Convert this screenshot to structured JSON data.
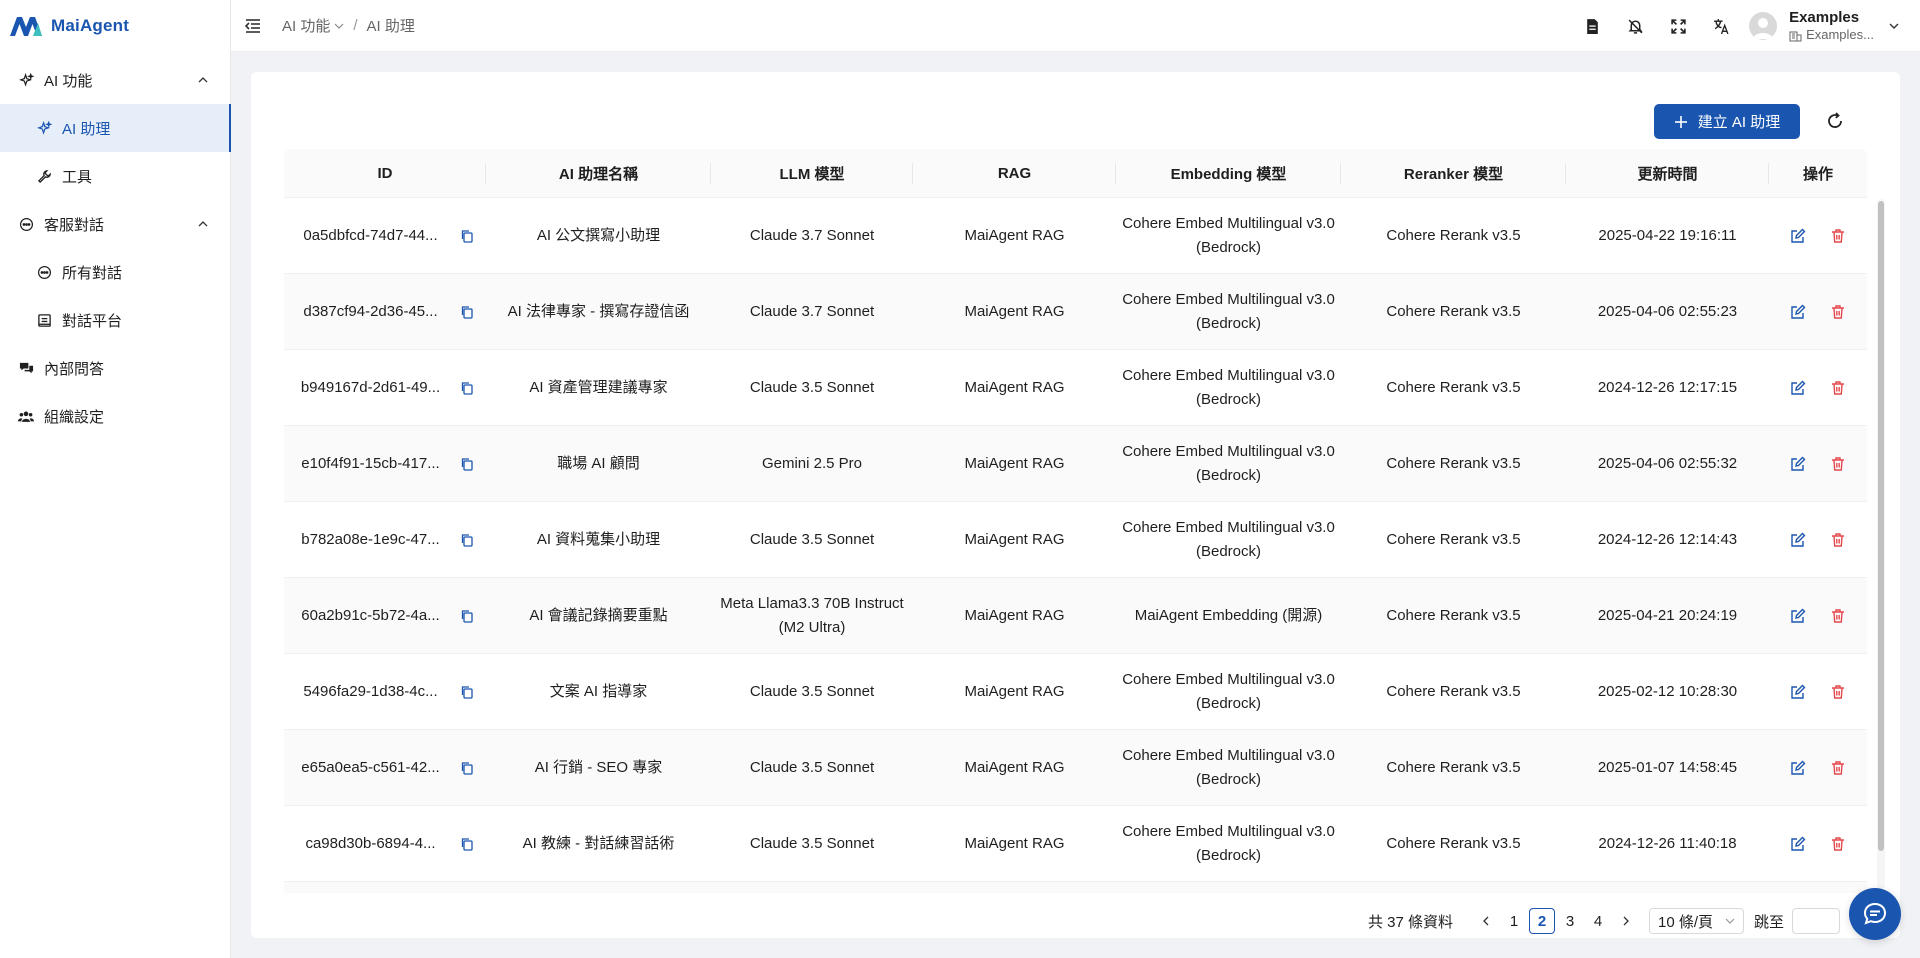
{
  "brand": {
    "name": "MaiAgent",
    "color": "#1a56b0"
  },
  "sidebar": {
    "groups": [
      {
        "label": "AI 功能",
        "icon": "sparkle-icon",
        "expanded": true,
        "items": [
          {
            "label": "AI 助理",
            "icon": "sparkle-icon",
            "active": true
          },
          {
            "label": "工具",
            "icon": "wrench-icon",
            "active": false
          }
        ]
      },
      {
        "label": "客服對話",
        "icon": "chat-bubble-icon",
        "expanded": true,
        "items": [
          {
            "label": "所有對話",
            "icon": "chat-bubble-icon",
            "active": false
          },
          {
            "label": "對話平台",
            "icon": "platform-icon",
            "active": false
          }
        ]
      },
      {
        "label": "內部問答",
        "icon": "comments-icon",
        "expanded": false,
        "items": []
      },
      {
        "label": "組織設定",
        "icon": "team-icon",
        "expanded": false,
        "items": []
      }
    ]
  },
  "header": {
    "breadcrumb": [
      "AI 功能",
      "AI 助理"
    ],
    "user": {
      "name": "Examples",
      "org": "Examples..."
    }
  },
  "toolbar": {
    "create_label": "建立 AI 助理"
  },
  "table": {
    "columns": [
      "ID",
      "AI 助理名稱",
      "LLM 模型",
      "RAG",
      "Embedding 模型",
      "Reranker 模型",
      "更新時間",
      "操作"
    ],
    "rows": [
      {
        "id": "0a5dbfcd-74d7-44...",
        "name": "AI 公文撰寫小助理",
        "llm": "Claude 3.7 Sonnet",
        "rag": "MaiAgent RAG",
        "embedding": "Cohere Embed Multilingual v3.0 (Bedrock)",
        "reranker": "Cohere Rerank v3.5",
        "updated": "2025-04-22 19:16:11"
      },
      {
        "id": "d387cf94-2d36-45...",
        "name": "AI 法律專家 - 撰寫存證信函",
        "llm": "Claude 3.7 Sonnet",
        "rag": "MaiAgent RAG",
        "embedding": "Cohere Embed Multilingual v3.0 (Bedrock)",
        "reranker": "Cohere Rerank v3.5",
        "updated": "2025-04-06 02:55:23"
      },
      {
        "id": "b949167d-2d61-49...",
        "name": "AI 資產管理建議專家",
        "llm": "Claude 3.5 Sonnet",
        "rag": "MaiAgent RAG",
        "embedding": "Cohere Embed Multilingual v3.0 (Bedrock)",
        "reranker": "Cohere Rerank v3.5",
        "updated": "2024-12-26 12:17:15"
      },
      {
        "id": "e10f4f91-15cb-417...",
        "name": "職場 AI 顧問",
        "llm": "Gemini 2.5 Pro",
        "rag": "MaiAgent RAG",
        "embedding": "Cohere Embed Multilingual v3.0 (Bedrock)",
        "reranker": "Cohere Rerank v3.5",
        "updated": "2025-04-06 02:55:32"
      },
      {
        "id": "b782a08e-1e9c-47...",
        "name": "AI 資料蒐集小助理",
        "llm": "Claude 3.5 Sonnet",
        "rag": "MaiAgent RAG",
        "embedding": "Cohere Embed Multilingual v3.0 (Bedrock)",
        "reranker": "Cohere Rerank v3.5",
        "updated": "2024-12-26 12:14:43"
      },
      {
        "id": "60a2b91c-5b72-4a...",
        "name": "AI 會議記錄摘要重點",
        "llm": "Meta Llama3.3 70B Instruct (M2 Ultra)",
        "rag": "MaiAgent RAG",
        "embedding": "MaiAgent Embedding (開源)",
        "reranker": "Cohere Rerank v3.5",
        "updated": "2025-04-21 20:24:19"
      },
      {
        "id": "5496fa29-1d38-4c...",
        "name": "文案 AI 指導家",
        "llm": "Claude 3.5 Sonnet",
        "rag": "MaiAgent RAG",
        "embedding": "Cohere Embed Multilingual v3.0 (Bedrock)",
        "reranker": "Cohere Rerank v3.5",
        "updated": "2025-02-12 10:28:30"
      },
      {
        "id": "e65a0ea5-c561-42...",
        "name": "AI 行銷 - SEO 專家",
        "llm": "Claude 3.5 Sonnet",
        "rag": "MaiAgent RAG",
        "embedding": "Cohere Embed Multilingual v3.0 (Bedrock)",
        "reranker": "Cohere Rerank v3.5",
        "updated": "2025-01-07 14:58:45"
      },
      {
        "id": "ca98d30b-6894-4...",
        "name": "AI 教練 - 對話練習話術",
        "llm": "Claude 3.5 Sonnet",
        "rag": "MaiAgent RAG",
        "embedding": "Cohere Embed Multilingual v3.0 (Bedrock)",
        "reranker": "Cohere Rerank v3.5",
        "updated": "2024-12-26 11:40:18"
      }
    ]
  },
  "pagination": {
    "total_label": "共 37 條資料",
    "pages": [
      "1",
      "2",
      "3",
      "4"
    ],
    "current": "2",
    "page_size": "10 條/頁",
    "jump_label": "跳至",
    "jump_value": ""
  },
  "colors": {
    "primary": "#1a56b0",
    "danger": "#e5484d",
    "bg": "#f0f2f5"
  }
}
